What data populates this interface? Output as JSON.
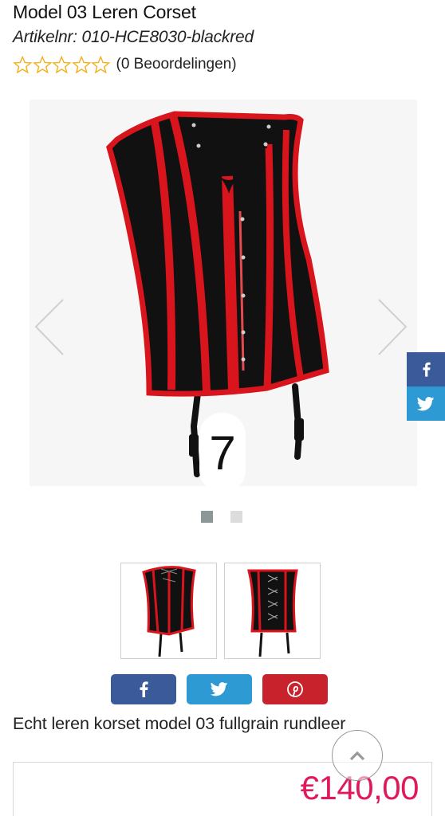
{
  "product": {
    "title": "Model 03 Leren Corset",
    "sku": "Artikelnr: 010-HCE8030-blackred",
    "rating": {
      "stars_filled": 0,
      "stars_total": 5,
      "text": "(0 Beoordelingen)"
    },
    "description": "Echt leren korset model 03 fullgrain rundleer",
    "price": "€140,00"
  },
  "gallery": {
    "slide_number": "7",
    "dots": [
      {
        "active": true
      },
      {
        "active": false
      }
    ],
    "thumbnails": [
      {
        "icon": "corset-front-thumb"
      },
      {
        "icon": "corset-back-thumb"
      }
    ]
  },
  "share": {
    "buttons": [
      {
        "icon": "facebook-icon",
        "color": "#3b5a9a"
      },
      {
        "icon": "twitter-icon",
        "color": "#2d9ad4"
      },
      {
        "icon": "pinterest-icon",
        "color": "#c8232c"
      }
    ],
    "side": [
      {
        "icon": "facebook-icon",
        "color": "#3b5a9a"
      },
      {
        "icon": "twitter-icon",
        "color": "#2d9ad4"
      }
    ]
  },
  "colors": {
    "price": "#e0195a",
    "star_outline": "#f2b01e",
    "accent_red": "#d8141c"
  }
}
